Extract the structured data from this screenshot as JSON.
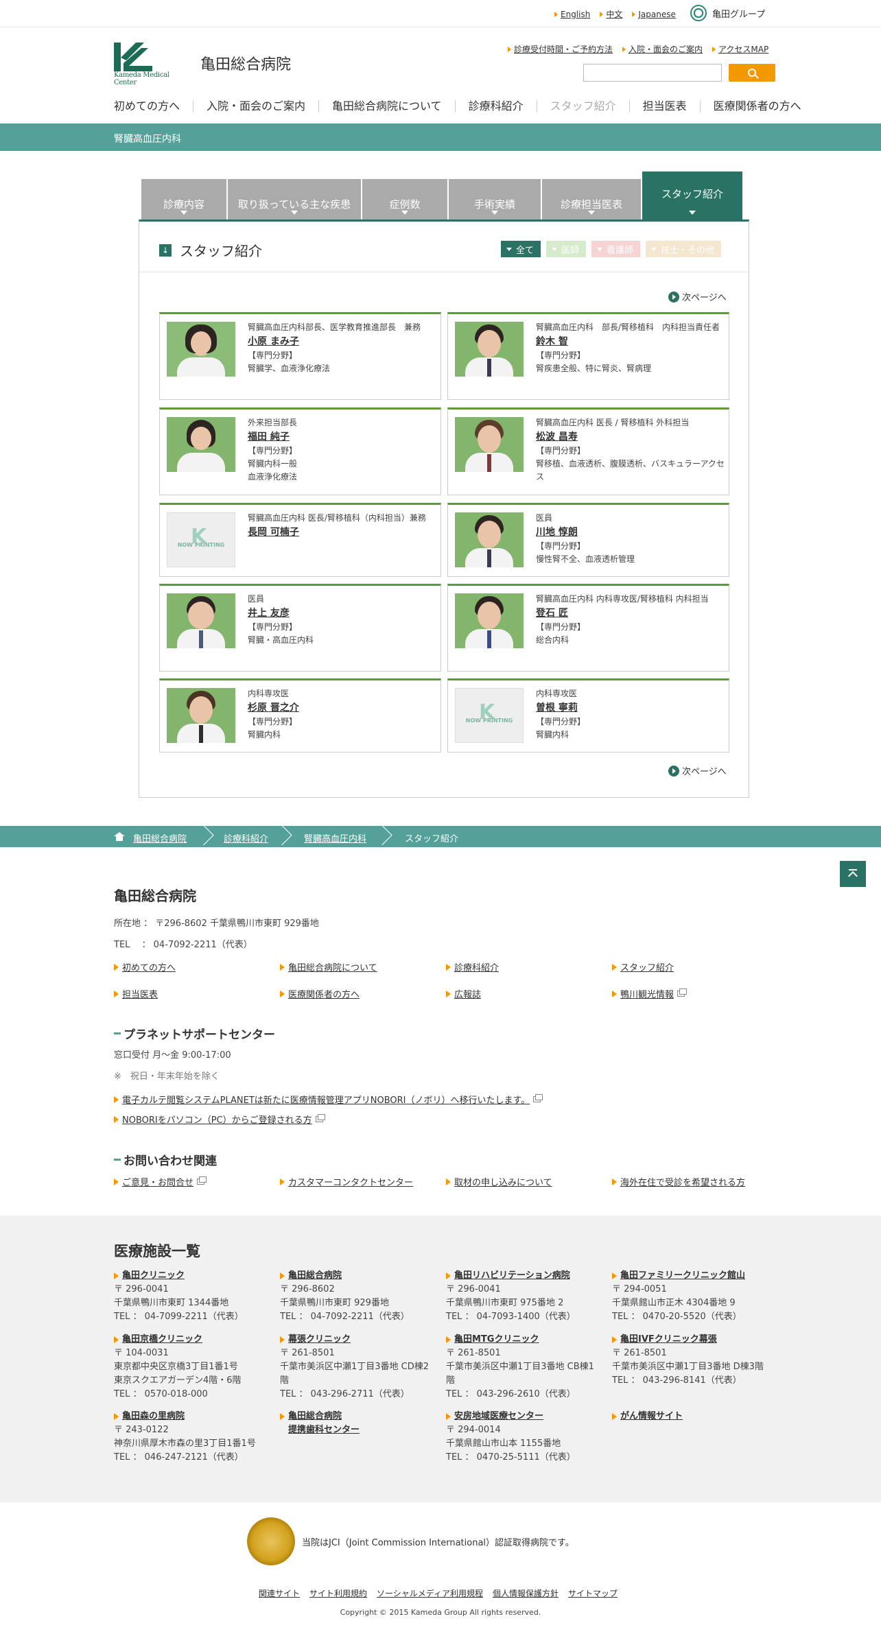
{
  "topbar": {
    "langs": [
      "English",
      "中文",
      "Japanese"
    ],
    "group": "亀田グループ"
  },
  "header": {
    "logo_text": "Kameda Medical Center",
    "hospital_name": "亀田総合病院",
    "sublinks": [
      "診療受付時間・ご予約方法",
      "入院・面会のご案内",
      "アクセスMAP"
    ],
    "search_placeholder": ""
  },
  "gnav": [
    "初めての方へ",
    "入院・面会のご案内",
    "亀田総合病院について",
    "診療科紹介",
    "スタッフ紹介",
    "担当医表",
    "医療関係者の方へ"
  ],
  "department": "腎臓高血圧内科",
  "tabs": [
    "診療内容",
    "取り扱っている主な疾患",
    "症例数",
    "手術実績",
    "診療担当医表",
    "スタッフ紹介"
  ],
  "panel": {
    "title": "スタッフ紹介",
    "filters": [
      "全て",
      "医師",
      "看護師",
      "技士・その他"
    ],
    "filter_colors": [
      "#2a7364",
      "#cfe7c4",
      "#f7d0d0",
      "#f6e2c4"
    ],
    "next_page": "次ページへ"
  },
  "staff": [
    {
      "title": "腎臓高血圧内科部長、医学教育推進部長　兼務",
      "name": "小原 まみ子",
      "field_label": "【専門分野】",
      "field": "腎臓学、血液浄化療法"
    },
    {
      "title": "腎臓高血圧内科　部長/腎移植科　内科担当責任者",
      "name": "鈴木 智",
      "field_label": "【専門分野】",
      "field": "腎疾患全般、特に腎炎、腎病理"
    },
    {
      "title": "外来担当部長",
      "name": "福田 純子",
      "field_label": "【専門分野】",
      "field": "腎臓内科一般\n血液浄化療法"
    },
    {
      "title": "腎臓高血圧内科 医長 / 腎移植科 外科担当",
      "name": "松波 昌寿",
      "field_label": "【専門分野】",
      "field": "腎移植、血液透析、腹膜透析、バスキュラーアクセス"
    },
    {
      "title": "腎臓高血圧内科 医長/腎移植科（内科担当）兼務",
      "name": "長岡 可楠子",
      "field_label": "",
      "field": ""
    },
    {
      "title": "医員",
      "name": "川地 惇朗",
      "field_label": "【専門分野】",
      "field": "慢性腎不全、血液透析管理"
    },
    {
      "title": "医員",
      "name": "井上 友彦",
      "field_label": "【専門分野】",
      "field": "腎臓・高血圧内科"
    },
    {
      "title": "腎臓高血圧内科 内科専攻医/腎移植科 内科担当",
      "name": "登石 匠",
      "field_label": "【専門分野】",
      "field": "総合内科"
    },
    {
      "title": "内科専攻医",
      "name": "杉原 晋之介",
      "field_label": "【専門分野】",
      "field": "腎臓内科"
    },
    {
      "title": "内科専攻医",
      "name": "曽根 寧莉",
      "field_label": "【専門分野】",
      "field": "腎臓内科"
    }
  ],
  "now_printing": "NOW PRINTING",
  "breadcrumb": [
    "亀田総合病院",
    "診療科紹介",
    "腎臓高血圧内科",
    "スタッフ紹介"
  ],
  "footer": {
    "name": "亀田総合病院",
    "address": "所在地 ： 〒296-8602 千葉県鴨川市東町 929番地",
    "tel": "TEL　 ： 04-7092-2211（代表）",
    "links": [
      "初めての方へ",
      "亀田総合病院について",
      "診療科紹介",
      "スタッフ紹介",
      "担当医表",
      "医療関係者の方へ",
      "広報誌",
      "鴨川観光情報"
    ],
    "planet": {
      "heading": "プラネットサポートセンター",
      "hours": "窓口受付 月～金 9:00-17:00",
      "note": "※　祝日・年末年始を除く",
      "links": [
        "電子カルテ閲覧システムPLANETは新たに医療情報管理アプリNOBORI（ノボリ）へ移行いたします。",
        "NOBORIをパソコン（PC）からご登録される方"
      ]
    },
    "contact": {
      "heading": "お問い合わせ関連",
      "links": [
        "ご意見・お問合せ",
        "カスタマーコンタクトセンター",
        "取材の申し込みについて",
        "海外在住で受診を希望される方"
      ]
    }
  },
  "facilities": {
    "heading": "医療施設一覧",
    "items": [
      {
        "name": "亀田クリニック",
        "lines": [
          "〒 296-0041",
          "千葉県鴨川市東町 1344番地",
          "TEL ： 04-7099-2211（代表）"
        ]
      },
      {
        "name": "亀田総合病院",
        "lines": [
          "〒 296-8602",
          "千葉県鴨川市東町 929番地",
          "TEL ： 04-7092-2211（代表）"
        ]
      },
      {
        "name": "亀田リハビリテーション病院",
        "lines": [
          "〒 296-0041",
          "千葉県鴨川市東町 975番地 2",
          "TEL ： 04-7093-1400（代表）"
        ]
      },
      {
        "name": "亀田ファミリークリニック館山",
        "lines": [
          "〒 294-0051",
          "千葉県館山市正木 4304番地 9",
          "TEL ： 0470-20-5520（代表）"
        ]
      },
      {
        "name": "亀田京橋クリニック",
        "lines": [
          "〒 104-0031",
          "東京都中央区京橋3丁目1番1号",
          "東京スクエアガーデン4階・6階",
          "TEL ： 0570-018-000"
        ]
      },
      {
        "name": "幕張クリニック",
        "lines": [
          "〒 261-8501",
          "千葉市美浜区中瀬1丁目3番地 CD棟2階",
          "TEL ： 043-296-2711（代表）"
        ]
      },
      {
        "name": "亀田MTGクリニック",
        "lines": [
          "〒 261-8501",
          "千葉市美浜区中瀬1丁目3番地 CB棟1階",
          "TEL ： 043-296-2610（代表）"
        ]
      },
      {
        "name": "亀田IVFクリニック幕張",
        "lines": [
          "〒 261-8501",
          "千葉市美浜区中瀬1丁目3番地 D棟3階",
          "TEL ： 043-296-8141（代表）"
        ]
      },
      {
        "name": "亀田森の里病院",
        "lines": [
          "〒 243-0122",
          "神奈川県厚木市森の里3丁目1番1号",
          "TEL ： 046-247-2121（代表）"
        ]
      },
      {
        "name": "亀田総合病院\n提携歯科センター",
        "lines": []
      },
      {
        "name": "安房地域医療センター",
        "lines": [
          "〒 294-0014",
          "千葉県館山市山本 1155番地",
          "TEL ： 0470-25-5111（代表）"
        ]
      },
      {
        "name": "がん情報サイト",
        "lines": []
      }
    ]
  },
  "jci": "当院はJCI（Joint Commission International）認証取得病院です。",
  "bottom_links": [
    "関連サイト",
    "サイト利用規約",
    "ソーシャルメディア利用規程",
    "個人情報保護方針",
    "サイトマップ"
  ],
  "copyright": "Copyright © 2015 Kameda Group All rights reserved."
}
